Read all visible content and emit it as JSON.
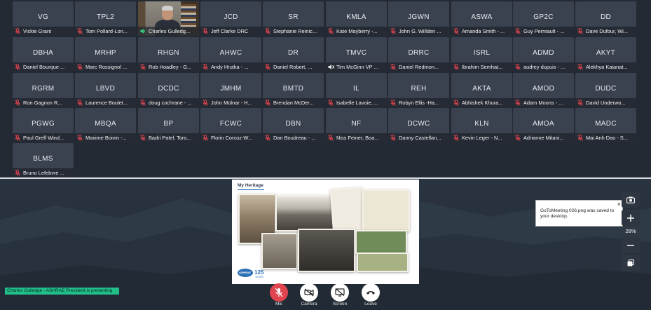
{
  "participants": [
    {
      "initials": "VG",
      "name": "Vickie Grant"
    },
    {
      "initials": "TPL2",
      "name": "Tom Pollard-Lon..."
    },
    {
      "initials": "",
      "name": "Charles Gulledg...",
      "video": true
    },
    {
      "initials": "JCD",
      "name": "Jeff Clarke DRC"
    },
    {
      "initials": "SR",
      "name": "Stephanie Reinic..."
    },
    {
      "initials": "KMLA",
      "name": "Kate Mayberry -..."
    },
    {
      "initials": "JGWN",
      "name": "John G. Willden ..."
    },
    {
      "initials": "ASWA",
      "name": "Amanda Smith - ..."
    },
    {
      "initials": "GP2C",
      "name": "Guy Perreault - ..."
    },
    {
      "initials": "DD",
      "name": "Dave Dufour, Wi..."
    },
    {
      "initials": "DBHA",
      "name": "Daniel Bourque ..."
    },
    {
      "initials": "MRHP",
      "name": "Marc Rossignol ..."
    },
    {
      "initials": "RHGN",
      "name": "Rob Hoadley - G..."
    },
    {
      "initials": "AHWC",
      "name": "Andy Hrutka - ..."
    },
    {
      "initials": "DR",
      "name": "Daniel Robert, ..."
    },
    {
      "initials": "TMVC",
      "name": "Tim McGinn VP ...",
      "speaker": true
    },
    {
      "initials": "DRRC",
      "name": "Daniel Redmon..."
    },
    {
      "initials": "ISRL",
      "name": "Ibrahim Semhat..."
    },
    {
      "initials": "ADMD",
      "name": "audrey dupuis - ..."
    },
    {
      "initials": "AKYT",
      "name": "Alekhya Kaianat..."
    },
    {
      "initials": "RGRM",
      "name": "Ron Gagnon R..."
    },
    {
      "initials": "LBVD",
      "name": "Laurence Boulet..."
    },
    {
      "initials": "DCDC",
      "name": "doug cochrane - ..."
    },
    {
      "initials": "JMHM",
      "name": "John Molnar - H..."
    },
    {
      "initials": "BMTD",
      "name": "Brendan McDer..."
    },
    {
      "initials": "IL",
      "name": "Isabelle Lavoie, ..."
    },
    {
      "initials": "REH",
      "name": "Robyn Ellis -Ha..."
    },
    {
      "initials": "AKTA",
      "name": "Abhishek Khura..."
    },
    {
      "initials": "AMOD",
      "name": "Adam Moons - ..."
    },
    {
      "initials": "DUDC",
      "name": "David Underwo..."
    },
    {
      "initials": "PGWG",
      "name": "Paul Greff Wind..."
    },
    {
      "initials": "MBQA",
      "name": "Maxime Boivin -..."
    },
    {
      "initials": "BP",
      "name": "Badri Patel, Toro..."
    },
    {
      "initials": "FCWC",
      "name": "Florin Corcoz-W..."
    },
    {
      "initials": "DBN",
      "name": "Dan Boudreau - ..."
    },
    {
      "initials": "NF",
      "name": "Niss Feiner, Boa..."
    },
    {
      "initials": "DCWC",
      "name": "Danny Castellan..."
    },
    {
      "initials": "KLN",
      "name": "Kevin Leger - N..."
    },
    {
      "initials": "AMOA",
      "name": "Adrianne Mitani..."
    },
    {
      "initials": "MADC",
      "name": "Mai Anh Dao - S..."
    },
    {
      "initials": "BLMS",
      "name": "Bruno Lefebvre ..."
    }
  ],
  "shared_screen": {
    "title": "My Heritage",
    "logo_text": "ASHRAE",
    "logo_number": "125",
    "logo_years": "YEARS"
  },
  "notification": {
    "message": "GoToMeeting 026.png was saved to your desktop."
  },
  "zoom": {
    "level": "28%"
  },
  "presenting": "Charles Gulledge - ASHRAE President is presenting",
  "controls": {
    "mic": "Mic",
    "camera": "Camera",
    "screen": "Screen",
    "leave": "Leave"
  },
  "colors": {
    "tile": "#3a4250",
    "mic_off": "#e0454f",
    "presenting_badge": "#21c08a",
    "mic_button": "#e0454f"
  }
}
